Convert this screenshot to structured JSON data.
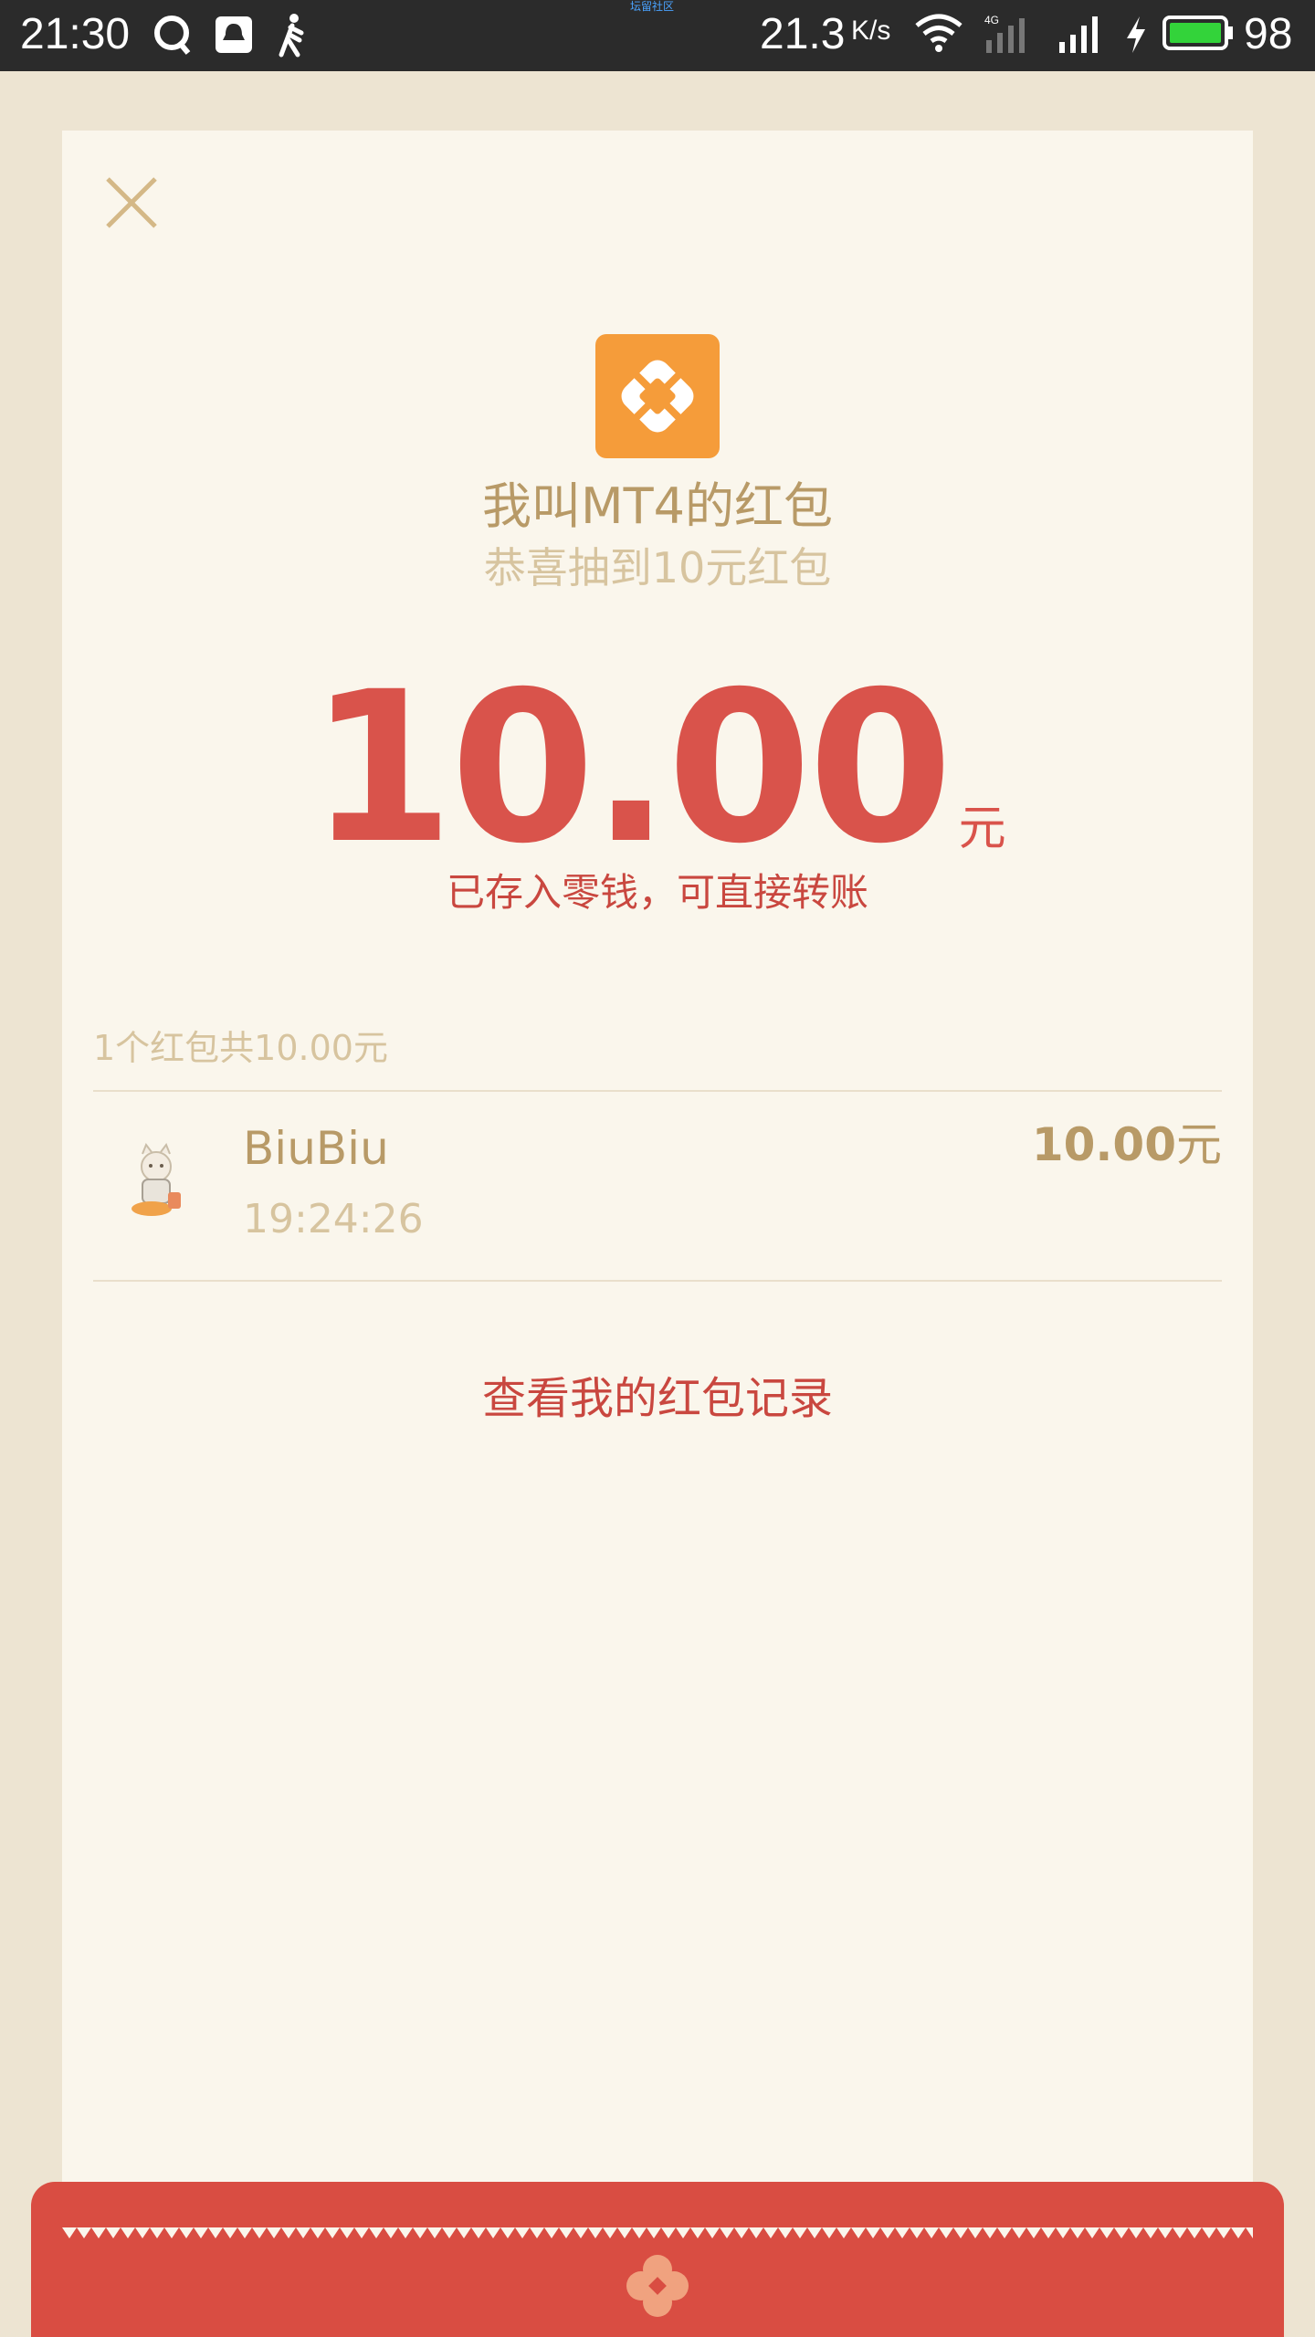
{
  "status_bar": {
    "time": "21:30",
    "tiny_label": "坛留社区",
    "net_speed": "21.3",
    "net_speed_unit": "K/s",
    "network": "4G",
    "battery": "98",
    "icons": [
      "qq-icon",
      "notification-icon",
      "walking-icon",
      "wifi-icon",
      "signal-icon",
      "charging-icon",
      "battery-icon"
    ]
  },
  "header": {
    "title": "我叫MT4的红包",
    "subtitle": "恭喜抽到10元红包"
  },
  "amount": {
    "value": "10.00",
    "unit": "元",
    "note": "已存入零钱，可直接转账"
  },
  "summary": "1个红包共10.00元",
  "records": [
    {
      "name": "BiuBiu",
      "time": "19:24:26",
      "amount": "10.00",
      "unit": "元"
    }
  ],
  "footer_link": "查看我的红包记录",
  "colors": {
    "accent_red": "#d9534b",
    "gold": "#b89a67",
    "logo_orange": "#f59c3a"
  }
}
